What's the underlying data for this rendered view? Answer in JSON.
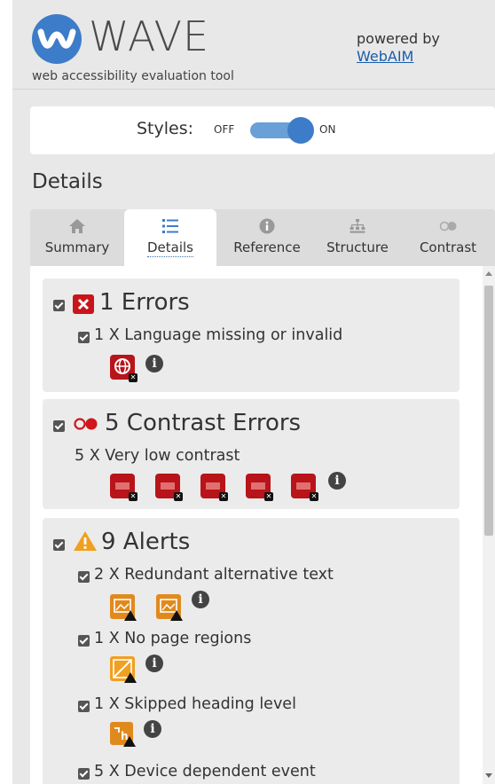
{
  "header": {
    "title": "WAVE",
    "subtitle": "web accessibility evaluation tool",
    "powered_by": "powered by",
    "webaim_link": "WebAIM"
  },
  "styles_toggle": {
    "label": "Styles:",
    "off": "OFF",
    "on": "ON",
    "state": "on"
  },
  "details_heading": "Details",
  "tabs": [
    {
      "label": "Summary",
      "icon": "home-icon",
      "active": false
    },
    {
      "label": "Details",
      "icon": "list-icon",
      "active": true
    },
    {
      "label": "Reference",
      "icon": "info-icon",
      "active": false
    },
    {
      "label": "Structure",
      "icon": "sitemap-icon",
      "active": false
    },
    {
      "label": "Contrast",
      "icon": "contrast-icon",
      "active": false
    }
  ],
  "sections": {
    "errors": {
      "title": "1 Errors",
      "items": [
        {
          "text": "1 X Language missing or invalid",
          "count": 1
        }
      ]
    },
    "contrast": {
      "title": "5 Contrast Errors",
      "items": [
        {
          "text": "5 X Very low contrast",
          "count": 5
        }
      ]
    },
    "alerts": {
      "title": "9 Alerts",
      "items": [
        {
          "text": "2 X Redundant alternative text",
          "count": 2
        },
        {
          "text": "1 X No page regions",
          "count": 1
        },
        {
          "text": "1 X Skipped heading level",
          "count": 1
        },
        {
          "text": "5 X Device dependent event",
          "count": 5
        }
      ]
    }
  },
  "colors": {
    "accent_blue": "#3d7cc9",
    "error_red": "#b8141a",
    "alert_orange": "#e08a1e"
  }
}
